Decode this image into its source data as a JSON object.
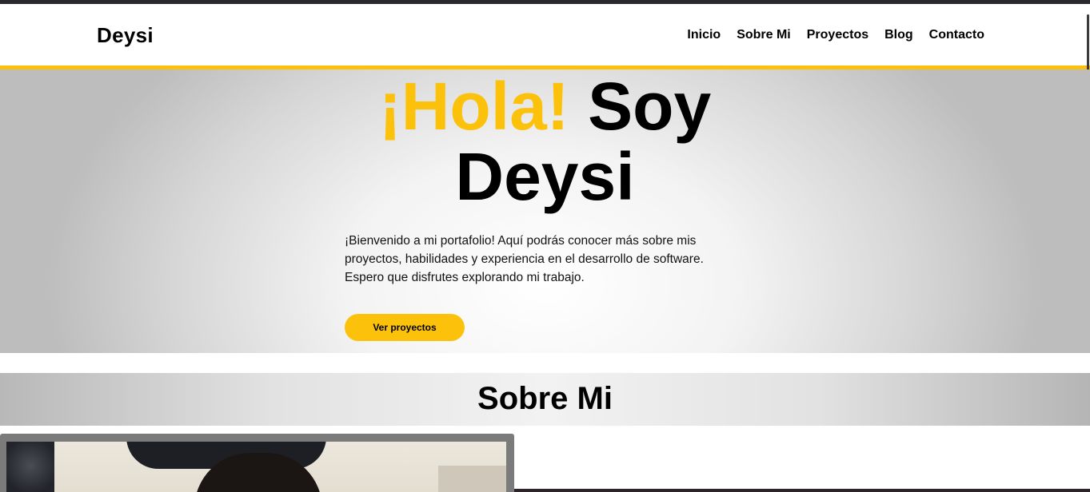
{
  "navbar": {
    "brand": "Deysi",
    "links": [
      "Inicio",
      "Sobre Mi",
      "Proyectos",
      "Blog",
      "Contacto"
    ]
  },
  "hero": {
    "greeting": "¡Hola!",
    "title_rest_line1": "Soy",
    "title_line2": "Deysi",
    "intro": "¡Bienvenido a mi portafolio! Aquí podrás conocer más sobre mis proyectos, habilidades y experiencia en el desarrollo de software. Espero que disfrutes explorando mi trabajo.",
    "cta_label": "Ver proyectos"
  },
  "about": {
    "title": "Sobre Mi"
  },
  "colors": {
    "accent": "#fcc20b",
    "text": "#000000"
  }
}
